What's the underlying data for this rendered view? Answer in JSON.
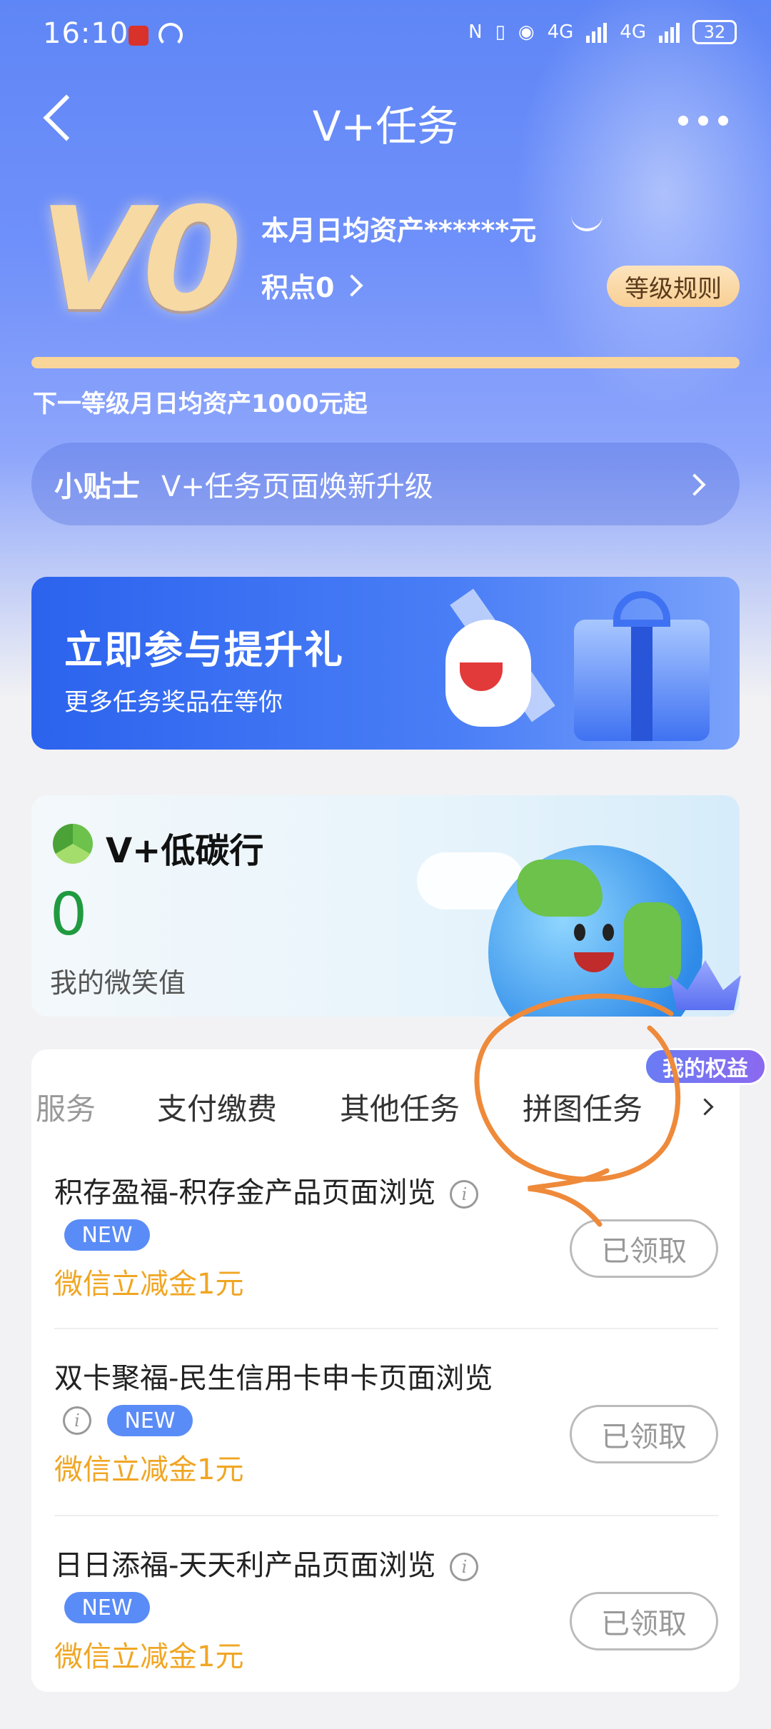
{
  "status_bar": {
    "time": "16:10",
    "network1": "4G",
    "network2": "4G",
    "battery": "32"
  },
  "nav": {
    "title": "V+任务"
  },
  "level": {
    "badge": "V0",
    "asset_text": "本月日均资产******元",
    "points_text": "积点0",
    "rules_label": "等级规则",
    "progress": 0,
    "next_level_text": "下一等级月日均资产1000元起"
  },
  "tips": {
    "label": "小贴士",
    "text": "V+任务页面焕新升级"
  },
  "promo": {
    "title": "立即参与提升礼",
    "subtitle": "更多任务奖品在等你"
  },
  "carbon": {
    "title": "V+低碳行",
    "value": "0",
    "value_label": "我的微笑值"
  },
  "perks": {
    "label": "我的权益"
  },
  "tabs": [
    "服务",
    "支付缴费",
    "其他任务",
    "拼图任务"
  ],
  "tasks": [
    {
      "name": "积存盈福-积存金产品页面浏览",
      "badge": "NEW",
      "reward": "微信立减金1元",
      "button": "已领取",
      "info_inline": true
    },
    {
      "name": "双卡聚福-民生信用卡申卡页面浏览",
      "badge": "NEW",
      "reward": "微信立减金1元",
      "button": "已领取",
      "info_inline": false
    },
    {
      "name": "日日添福-天天利产品页面浏览",
      "badge": "NEW",
      "reward": "微信立减金1元",
      "button": "已领取",
      "info_inline": true
    }
  ],
  "colors": {
    "accent": "#5f86f6",
    "reward": "#f0a623",
    "carbon_value": "#1f9a3f",
    "annotation": "#ee8a3a"
  }
}
